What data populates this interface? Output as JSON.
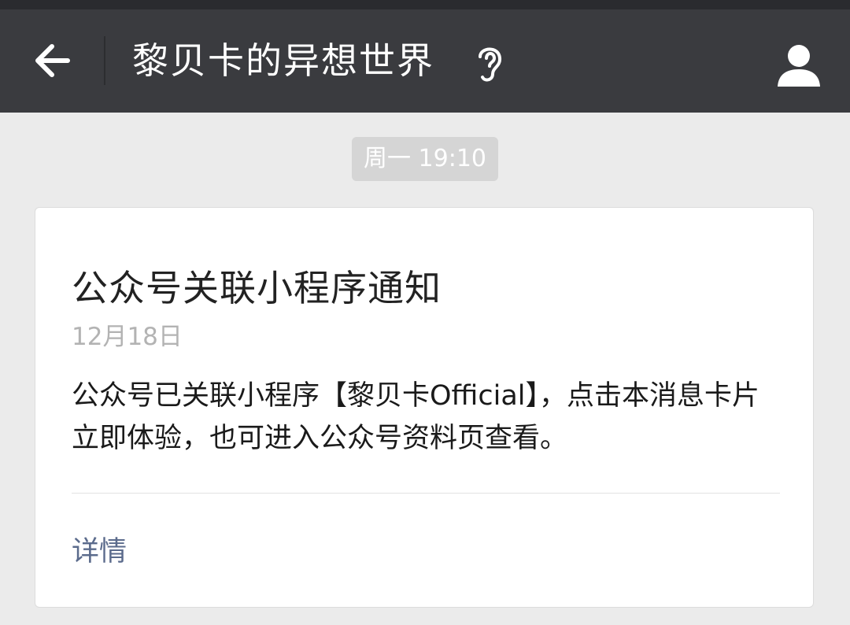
{
  "navbar": {
    "back_icon": "arrow-left-icon",
    "title": "黎贝卡的异想世界",
    "listen_icon": "ear-icon",
    "profile_icon": "person-icon",
    "background_color": "#3a3b3f"
  },
  "chat": {
    "timestamp": "周一 19:10"
  },
  "card": {
    "title": "公众号关联小程序通知",
    "date": "12月18日",
    "body": "公众号已关联小程序【黎贝卡Official】，点击本消息卡片立即体验，也可进入公众号资料页查看。",
    "detail_label": "详情",
    "link_color": "#5b6b8c"
  }
}
